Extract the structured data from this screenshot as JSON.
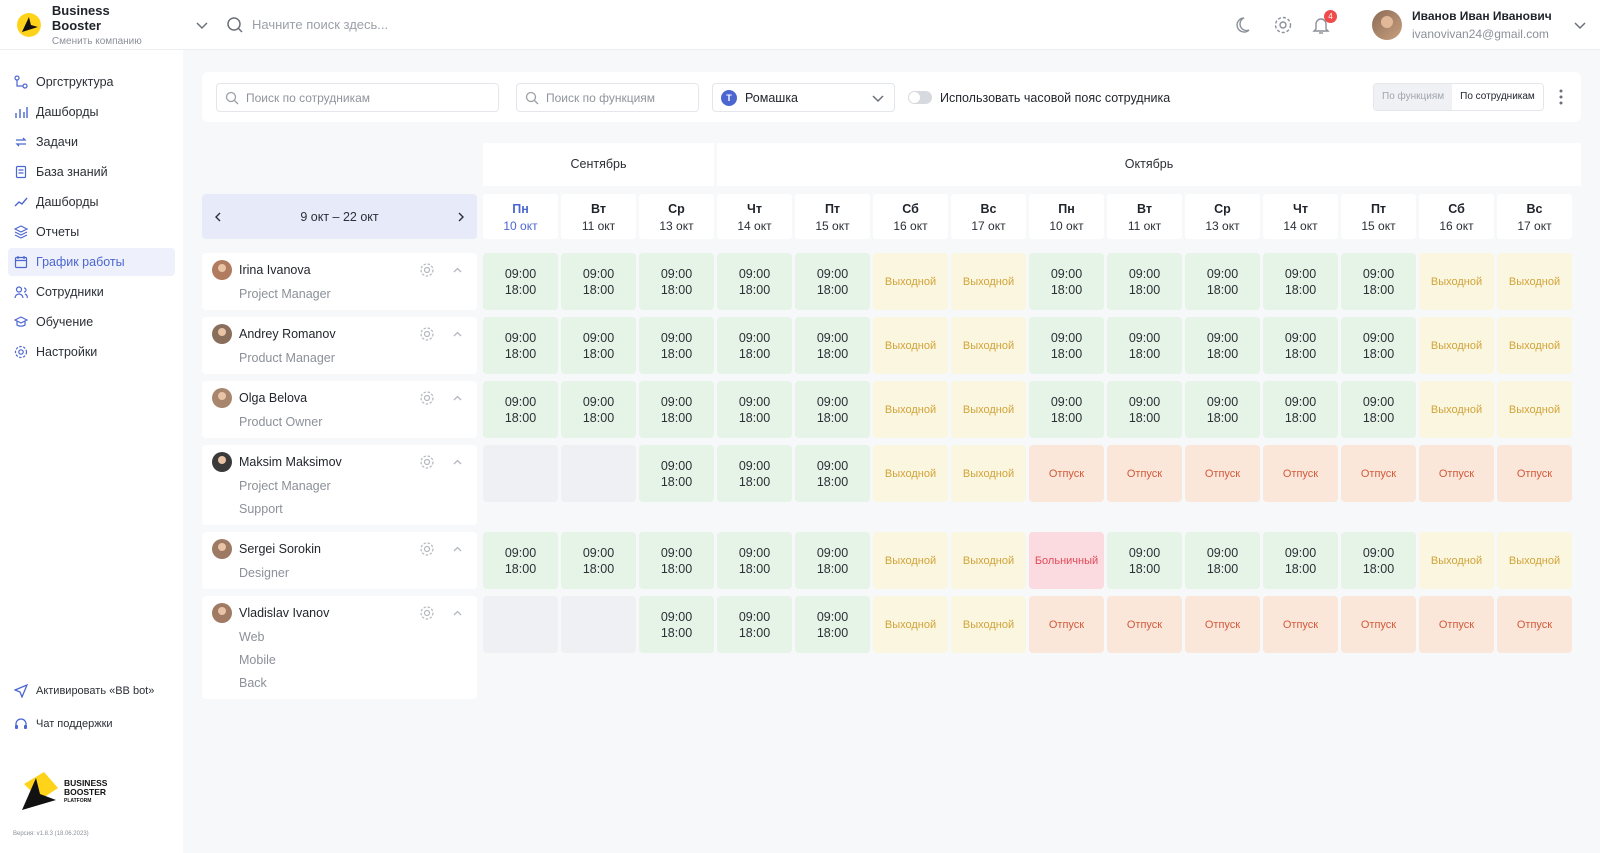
{
  "header": {
    "company_name": "Business Booster",
    "company_sub": "Сменить компанию",
    "search_placeholder": "Начните поиск здесь...",
    "notifications_count": "4",
    "user_name": "Иванов Иван Иванович",
    "user_email": "ivanovivan24@gmail.com"
  },
  "sidebar": {
    "items": [
      {
        "label": "Оргструктура",
        "icon": "org-structure-icon"
      },
      {
        "label": "Дашборды",
        "icon": "bar-chart-icon"
      },
      {
        "label": "Задачи",
        "icon": "tasks-icon"
      },
      {
        "label": "База знаний",
        "icon": "document-icon"
      },
      {
        "label": "Дашборды",
        "icon": "trend-icon"
      },
      {
        "label": "Отчеты",
        "icon": "layers-icon"
      },
      {
        "label": "График работы",
        "icon": "calendar-icon",
        "active": true
      },
      {
        "label": "Сотрудники",
        "icon": "users-icon"
      },
      {
        "label": "Обучение",
        "icon": "graduation-icon"
      },
      {
        "label": "Настройки",
        "icon": "settings-icon"
      }
    ],
    "bot_link": "Активировать «BB bot»",
    "support_link": "Чат поддержки",
    "logo_line1": "BUSINESS",
    "logo_line2": "BOOSTER",
    "logo_line3": "PLATFORM",
    "version": "Версия: v1.8.3 (18.06.2023)"
  },
  "filters": {
    "employee_search_placeholder": "Поиск по сотрудникам",
    "function_search_placeholder": "Поиск по функциям",
    "company_initial": "Т",
    "company_value": "Ромашка",
    "timezone_label": "Использовать часовой пояс сотрудника",
    "view_by_function": "По функциям",
    "view_by_employee": "По сотрудникам"
  },
  "schedule": {
    "months": [
      "Сентябрь",
      "Октябрь"
    ],
    "range": "9 окт  –  22 окт",
    "days": [
      {
        "name": "Пн",
        "date": "10 окт"
      },
      {
        "name": "Вт",
        "date": "11 окт"
      },
      {
        "name": "Ср",
        "date": "13 окт"
      },
      {
        "name": "Чт",
        "date": "14 окт"
      },
      {
        "name": "Пт",
        "date": "15 окт"
      },
      {
        "name": "Сб",
        "date": "16 окт"
      },
      {
        "name": "Вс",
        "date": "17 окт"
      },
      {
        "name": "Пн",
        "date": "10 окт"
      },
      {
        "name": "Вт",
        "date": "11 окт"
      },
      {
        "name": "Ср",
        "date": "13 окт"
      },
      {
        "name": "Чт",
        "date": "14 окт"
      },
      {
        "name": "Пт",
        "date": "15 окт"
      },
      {
        "name": "Сб",
        "date": "16 окт"
      },
      {
        "name": "Вс",
        "date": "17 окт"
      }
    ],
    "labels": {
      "start": "09:00",
      "end": "18:00",
      "off": "Выходной",
      "vacation": "Отпуск",
      "sick": "Больничный"
    },
    "employees": [
      {
        "name": "Irina Ivanova",
        "roles": [
          "Project Manager"
        ],
        "cells": [
          "w",
          "w",
          "w",
          "w",
          "w",
          "o",
          "o",
          "w",
          "w",
          "w",
          "w",
          "w",
          "o",
          "o"
        ]
      },
      {
        "name": "Andrey Romanov",
        "roles": [
          "Product Manager"
        ],
        "cells": [
          "w",
          "w",
          "w",
          "w",
          "w",
          "o",
          "o",
          "w",
          "w",
          "w",
          "w",
          "w",
          "o",
          "o"
        ]
      },
      {
        "name": "Olga Belova",
        "roles": [
          "Product Owner"
        ],
        "cells": [
          "w",
          "w",
          "w",
          "w",
          "w",
          "o",
          "o",
          "w",
          "w",
          "w",
          "w",
          "w",
          "o",
          "o"
        ]
      },
      {
        "name": "Maksim Maksimov",
        "roles": [
          "Project Manager",
          "Support"
        ],
        "cells": [
          "e",
          "e",
          "w",
          "w",
          "w",
          "o",
          "o",
          "v",
          "v",
          "v",
          "v",
          "v",
          "v",
          "v"
        ]
      },
      {
        "name": "Sergei Sorokin",
        "roles": [
          "Designer"
        ],
        "cells": [
          "w",
          "w",
          "w",
          "w",
          "w",
          "o",
          "o",
          "s",
          "w",
          "w",
          "w",
          "w",
          "o",
          "o"
        ]
      },
      {
        "name": "Vladislav Ivanov",
        "roles": [
          "Web",
          "Mobile",
          "Back"
        ],
        "cells": [
          "e",
          "e",
          "w",
          "w",
          "w",
          "o",
          "o",
          "v",
          "v",
          "v",
          "v",
          "v",
          "v",
          "v"
        ]
      }
    ]
  },
  "colors": {
    "accent": "#4b66d1",
    "work_bg": "#e6f3e7",
    "off_bg": "#fbf6df",
    "vacation_bg": "#fbe6da",
    "sick_bg": "#fbdbdf",
    "badge": "#ef4b4b"
  }
}
